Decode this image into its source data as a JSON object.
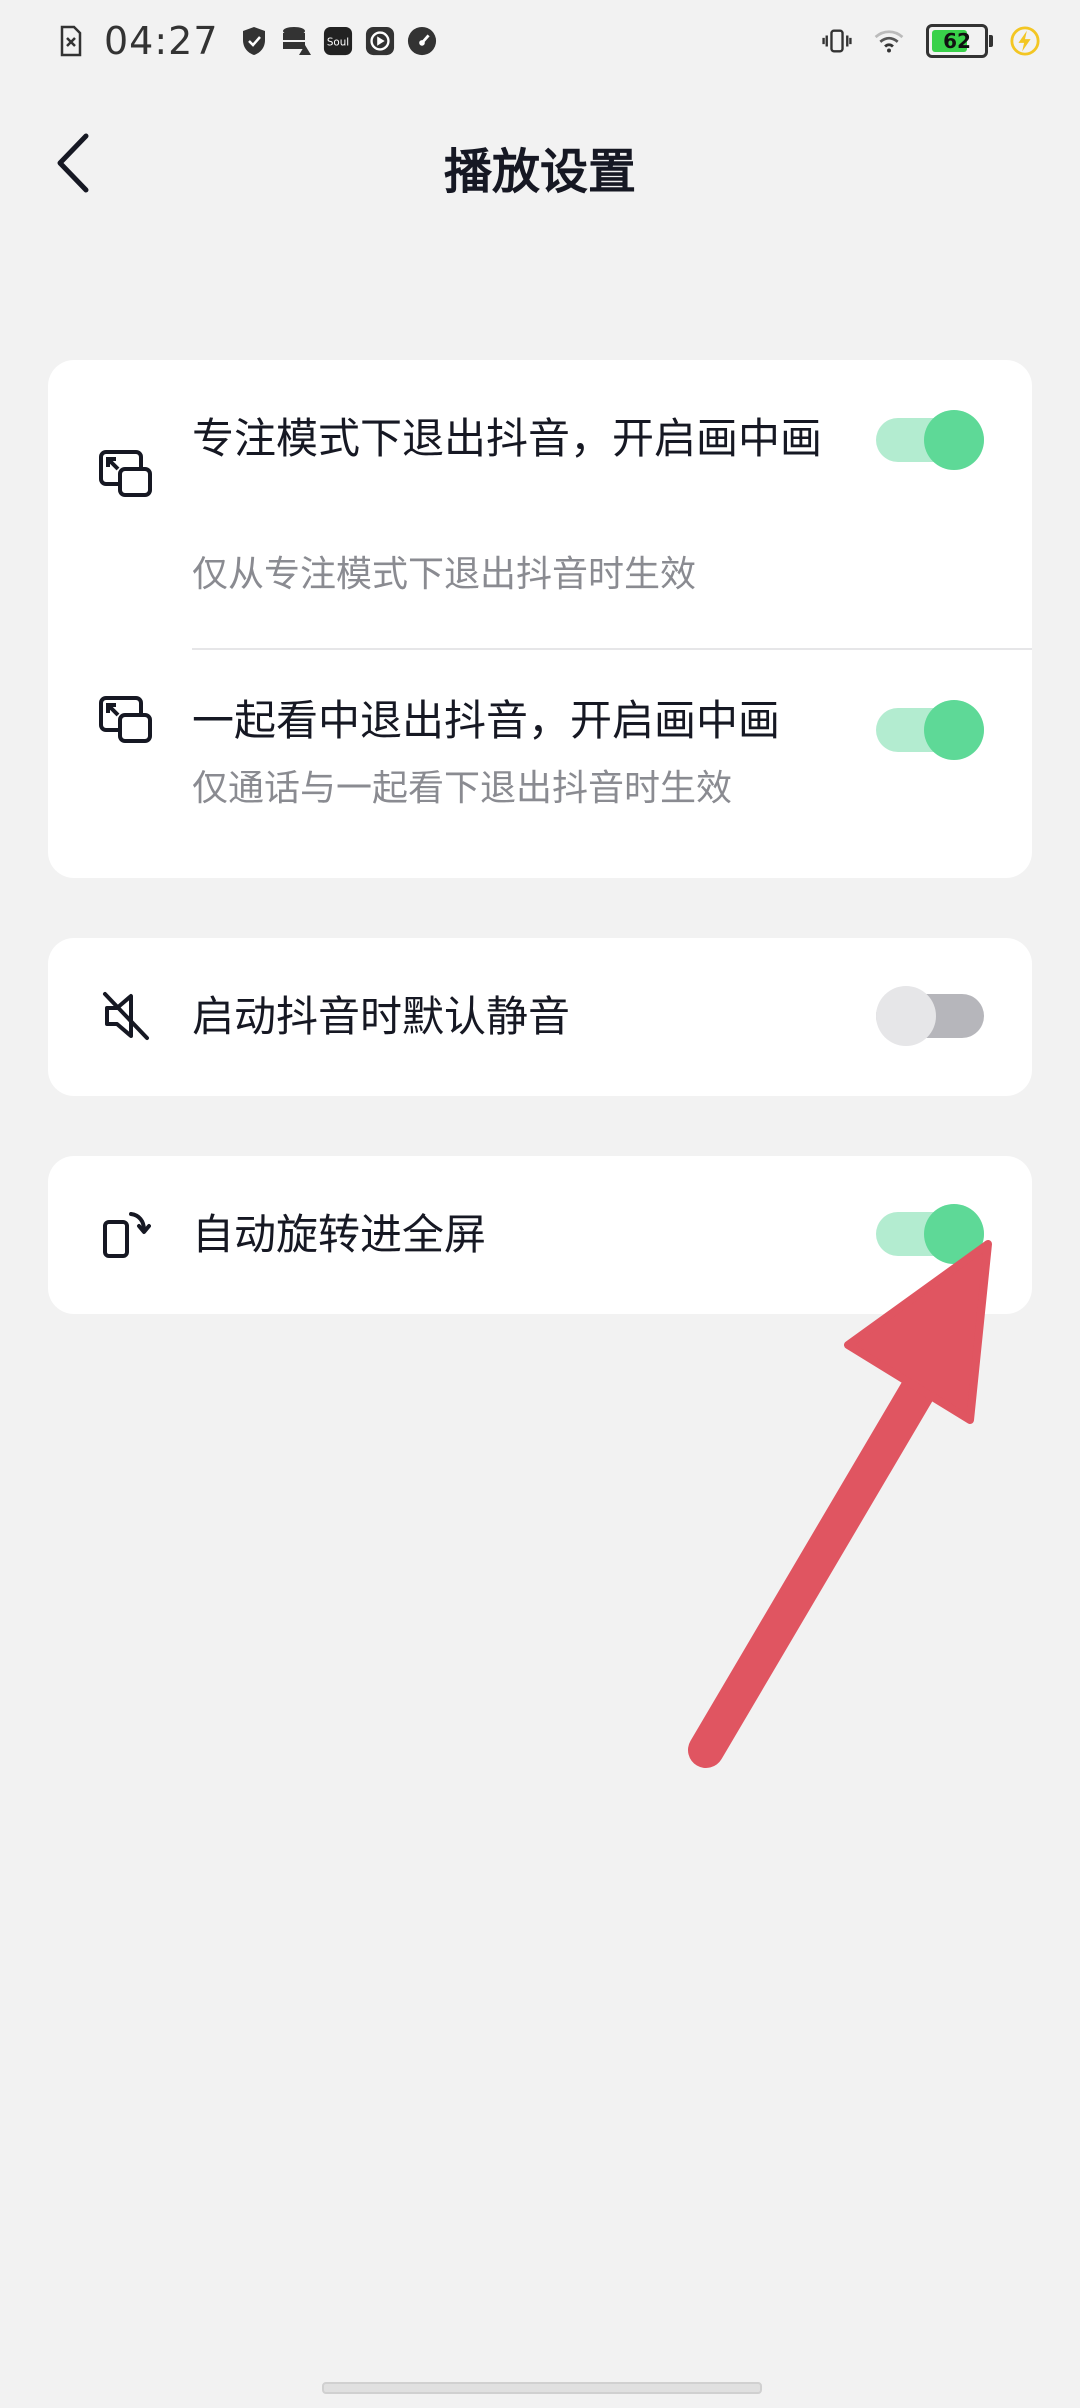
{
  "status_bar": {
    "time": "04:27",
    "battery_level": "62",
    "icons_left": [
      "sim-off-icon",
      "shield-icon",
      "storage-icon",
      "soul-app-icon",
      "play-icon",
      "speed-icon"
    ],
    "icons_right": [
      "vibrate-icon",
      "wifi-icon",
      "battery-icon",
      "charging-icon"
    ],
    "soul_label": "Soul"
  },
  "header": {
    "title": "播放设置"
  },
  "settings": {
    "pip_focus": {
      "title": "专注模式下退出抖音，开启画中画",
      "subtitle": "仅从专注模式下退出抖音时生效",
      "enabled": true
    },
    "pip_watch_together": {
      "title": "一起看中退出抖音，开启画中画",
      "subtitle": "仅通话与一起看下退出抖音时生效",
      "enabled": true
    },
    "default_mute": {
      "title": "启动抖音时默认静音",
      "enabled": false
    },
    "auto_rotate": {
      "title": "自动旋转进全屏",
      "enabled": true
    }
  },
  "colors": {
    "toggle_on_track": "#b3ecd0",
    "toggle_on_knob": "#5ed997",
    "toggle_off_track": "#b6b6bb",
    "arrow": "#e05561"
  }
}
